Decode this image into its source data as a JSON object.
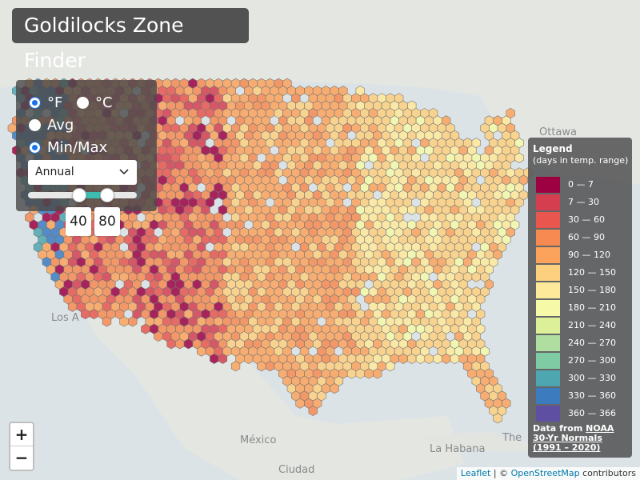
{
  "title": "Goldilocks Zone Finder",
  "units": {
    "fahrenheit": "°F",
    "celsius": "°C",
    "selected": "fahrenheit"
  },
  "mode": {
    "avg": "Avg",
    "minmax": "Min/Max",
    "selected": "minmax"
  },
  "period": {
    "selected": "Annual"
  },
  "range": {
    "min": "40",
    "max": "80"
  },
  "legend": {
    "title": "Legend",
    "subtitle": "(days in temp. range)",
    "items": [
      {
        "label": "0 — 7",
        "color": "#9e0142"
      },
      {
        "label": "7 — 30",
        "color": "#d53e4f"
      },
      {
        "label": "30 — 60",
        "color": "#e8564d"
      },
      {
        "label": "60 — 90",
        "color": "#f68a50"
      },
      {
        "label": "90 — 120",
        "color": "#fba35d"
      },
      {
        "label": "120 — 150",
        "color": "#fdd07f"
      },
      {
        "label": "150 — 180",
        "color": "#fee99a"
      },
      {
        "label": "180 — 210",
        "color": "#f5f9a8"
      },
      {
        "label": "210 — 240",
        "color": "#dcf09a"
      },
      {
        "label": "240 — 270",
        "color": "#b0dea0"
      },
      {
        "label": "270 — 300",
        "color": "#7fcba4"
      },
      {
        "label": "300 — 330",
        "color": "#4ea7b0"
      },
      {
        "label": "330 — 360",
        "color": "#3d7bbf"
      },
      {
        "label": "360 — 366",
        "color": "#5e4fa2"
      }
    ],
    "source_prefix": "Data from ",
    "source_link": "NOAA 30-Yr Normals (1991 – 2020)"
  },
  "map_labels": {
    "ottawa": "Ottawa",
    "los_angeles": "Los A",
    "mexico": "México",
    "la_habana": "La Habana",
    "ciudad": "Ciudad",
    "the": "The"
  },
  "zoom": {
    "in": "+",
    "out": "−"
  },
  "attribution": {
    "leaflet": "Leaflet",
    "sep": " | © ",
    "osm": "OpenStreetMap",
    "suffix": " contributors"
  }
}
